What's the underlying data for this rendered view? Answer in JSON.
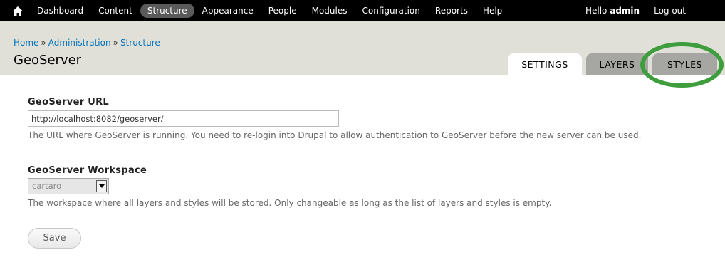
{
  "toolbar": {
    "home_icon": "home-icon",
    "menu": [
      {
        "label": "Dashboard",
        "active": false
      },
      {
        "label": "Content",
        "active": false
      },
      {
        "label": "Structure",
        "active": true
      },
      {
        "label": "Appearance",
        "active": false
      },
      {
        "label": "People",
        "active": false
      },
      {
        "label": "Modules",
        "active": false
      },
      {
        "label": "Configuration",
        "active": false
      },
      {
        "label": "Reports",
        "active": false
      },
      {
        "label": "Help",
        "active": false
      }
    ],
    "hello_prefix": "Hello",
    "username": "admin",
    "logout_label": "Log out"
  },
  "breadcrumb": {
    "items": [
      "Home",
      "Administration",
      "Structure"
    ],
    "separator": "»"
  },
  "page_title": "GeoServer",
  "tabs": [
    {
      "label": "SETTINGS",
      "active": true
    },
    {
      "label": "LAYERS",
      "active": false
    },
    {
      "label": "STYLES",
      "active": false
    }
  ],
  "annotation": {
    "highlighted_tab": "STYLES",
    "color": "#3e9e3e"
  },
  "form": {
    "url_field": {
      "label": "GeoServer URL",
      "value": "http://localhost:8082/geoserver/",
      "description": "The URL where GeoServer is running. You need to re-login into Drupal to allow authentication to GeoServer before the new server can be used."
    },
    "workspace_field": {
      "label": "GeoServer Workspace",
      "selected": "cartaro",
      "disabled": true,
      "description": "The workspace where all layers and styles will be stored. Only changeable as long as the list of layers and styles is empty."
    },
    "save_label": "Save"
  },
  "colors": {
    "toolbar_bg": "#000000",
    "header_bg": "#e0e0d8",
    "link": "#0074bd",
    "tab_inactive": "#a6a7a2",
    "active_menu_pill": "#5a5a5a"
  }
}
